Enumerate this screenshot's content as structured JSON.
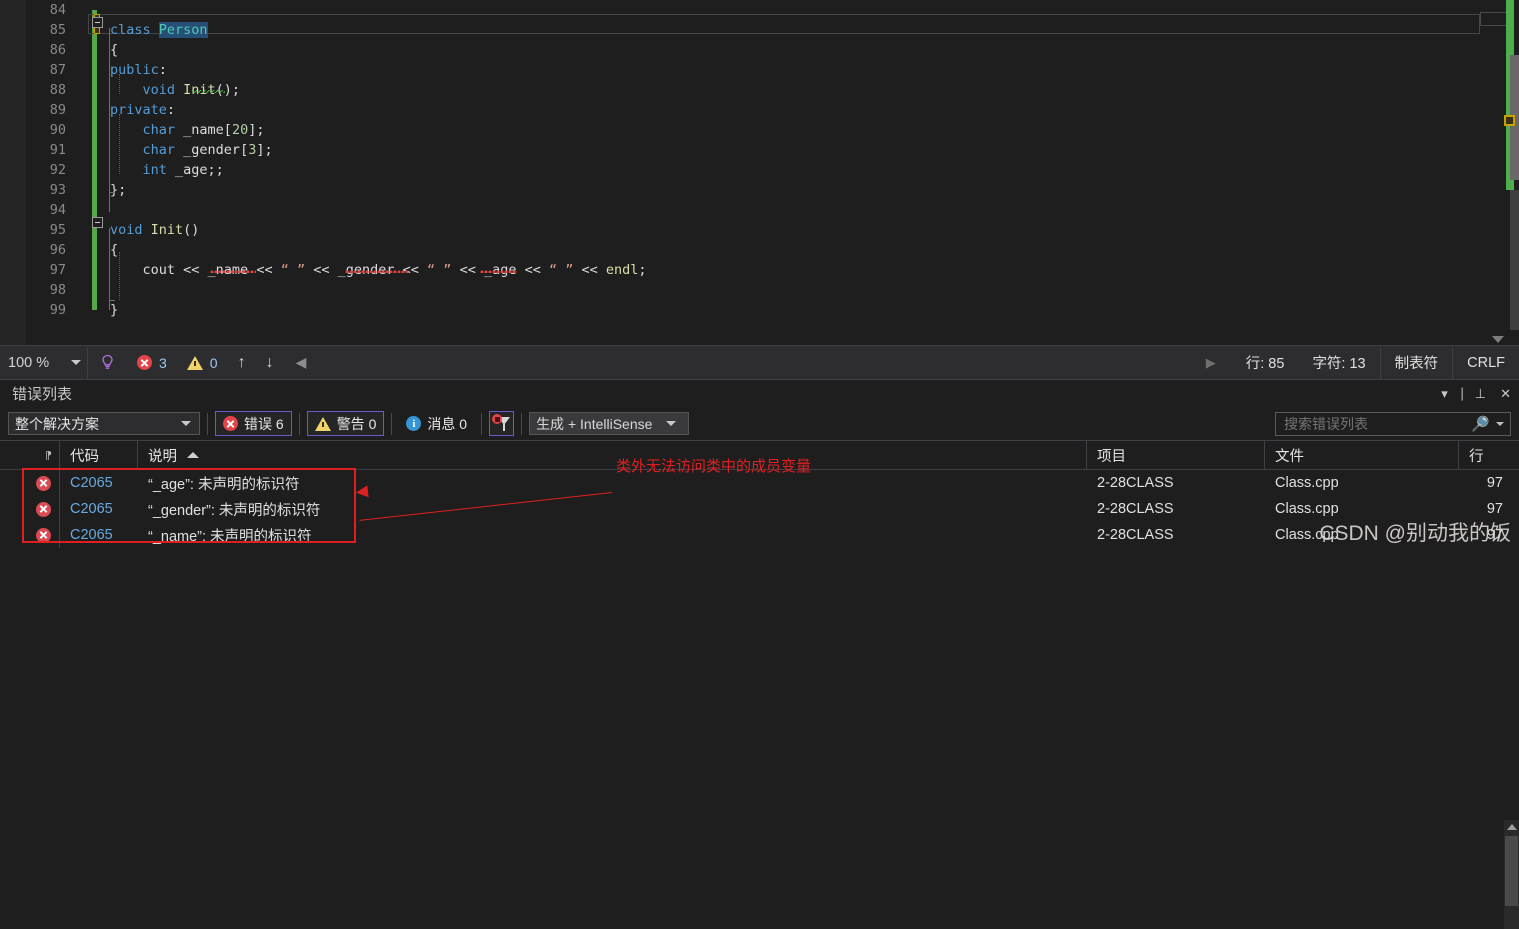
{
  "editor": {
    "lines": [
      {
        "no": "84",
        "tokens": []
      },
      {
        "no": "85",
        "tokens": [
          {
            "t": "class ",
            "c": "kw"
          },
          {
            "t": "Person",
            "c": "sel"
          }
        ]
      },
      {
        "no": "86",
        "tokens": [
          {
            "t": "{",
            "c": "punct"
          }
        ]
      },
      {
        "no": "87",
        "tokens": [
          {
            "t": "public",
            "c": "kw"
          },
          {
            "t": ":",
            "c": "punct"
          }
        ]
      },
      {
        "no": "88",
        "tokens": [
          {
            "t": "    ",
            "c": "idf"
          },
          {
            "t": "void ",
            "c": "kw"
          },
          {
            "t": "Init",
            "c": "fn"
          },
          {
            "t": "();",
            "c": "punct"
          }
        ]
      },
      {
        "no": "89",
        "tokens": [
          {
            "t": "private",
            "c": "kw"
          },
          {
            "t": ":",
            "c": "punct"
          }
        ]
      },
      {
        "no": "90",
        "tokens": [
          {
            "t": "    ",
            "c": "idf"
          },
          {
            "t": "char ",
            "c": "kw"
          },
          {
            "t": "_name",
            "c": "idf"
          },
          {
            "t": "[",
            "c": "punct"
          },
          {
            "t": "20",
            "c": "num"
          },
          {
            "t": "];",
            "c": "punct"
          }
        ]
      },
      {
        "no": "91",
        "tokens": [
          {
            "t": "    ",
            "c": "idf"
          },
          {
            "t": "char ",
            "c": "kw"
          },
          {
            "t": "_gender",
            "c": "idf"
          },
          {
            "t": "[",
            "c": "punct"
          },
          {
            "t": "3",
            "c": "num"
          },
          {
            "t": "];",
            "c": "punct"
          }
        ]
      },
      {
        "no": "92",
        "tokens": [
          {
            "t": "    ",
            "c": "idf"
          },
          {
            "t": "int ",
            "c": "kw"
          },
          {
            "t": "_age",
            "c": "idf"
          },
          {
            "t": ";;",
            "c": "punct"
          }
        ]
      },
      {
        "no": "93",
        "tokens": [
          {
            "t": "};",
            "c": "punct"
          }
        ]
      },
      {
        "no": "94",
        "tokens": []
      },
      {
        "no": "95",
        "tokens": [
          {
            "t": "void ",
            "c": "kw"
          },
          {
            "t": "Init",
            "c": "fn"
          },
          {
            "t": "()",
            "c": "punct"
          }
        ]
      },
      {
        "no": "96",
        "tokens": [
          {
            "t": "{",
            "c": "punct"
          }
        ]
      },
      {
        "no": "97",
        "tokens": [
          {
            "t": "    ",
            "c": "idf"
          },
          {
            "t": "cout ",
            "c": "idf"
          },
          {
            "t": "<< ",
            "c": "punct"
          },
          {
            "t": "_name ",
            "c": "idf"
          },
          {
            "t": "<< ",
            "c": "punct"
          },
          {
            "t": "“ ” ",
            "c": "str"
          },
          {
            "t": "<< ",
            "c": "punct"
          },
          {
            "t": "_gender ",
            "c": "idf"
          },
          {
            "t": "<< ",
            "c": "punct"
          },
          {
            "t": "“ ” ",
            "c": "str"
          },
          {
            "t": "<< ",
            "c": "punct"
          },
          {
            "t": "_age ",
            "c": "idf"
          },
          {
            "t": "<< ",
            "c": "punct"
          },
          {
            "t": "“ ” ",
            "c": "str"
          },
          {
            "t": "<< ",
            "c": "punct"
          },
          {
            "t": "endl",
            "c": "fn"
          },
          {
            "t": ";",
            "c": "punct"
          }
        ]
      },
      {
        "no": "98",
        "tokens": []
      },
      {
        "no": "99",
        "tokens": [
          {
            "t": "}",
            "c": "punct"
          }
        ]
      }
    ]
  },
  "statusbar": {
    "zoom": "100 %",
    "error_count": "3",
    "warning_count": "0",
    "line_label": "行: 85",
    "char_label": "字符: 13",
    "tabs_label": "制表符",
    "eol_label": "CRLF"
  },
  "panel": {
    "title": "错误列表",
    "toolbar": {
      "scope": "整个解决方案",
      "errors": "错误 6",
      "warnings": "警告 0",
      "messages": "消息 0",
      "build_source": "生成 + IntelliSense"
    },
    "search": {
      "placeholder": "搜索错误列表",
      "value": ""
    },
    "columns": {
      "code": "代码",
      "description": "说明",
      "project": "项目",
      "file": "文件",
      "line": "行"
    },
    "rows": [
      {
        "code": "C2065",
        "description": "“_age”: 未声明的标识符",
        "project": "2-28CLASS",
        "file": "Class.cpp",
        "line": "97"
      },
      {
        "code": "C2065",
        "description": "“_gender”: 未声明的标识符",
        "project": "2-28CLASS",
        "file": "Class.cpp",
        "line": "97"
      },
      {
        "code": "C2065",
        "description": "“_name”: 未声明的标识符",
        "project": "2-28CLASS",
        "file": "Class.cpp",
        "line": "97"
      }
    ]
  },
  "annotation": {
    "text": "类外无法访问类中的成员变量",
    "color": "#e02020"
  },
  "watermark": "CSDN @别动我的饭",
  "colors": {
    "editor_bg": "#1e1e1e",
    "keyword": "#569cd6",
    "type": "#4ec9b0",
    "function": "#dcdcaa",
    "number": "#b5cea8",
    "string": "#d69d85",
    "accent_purple": "#6a5acd",
    "error_red": "#e2444a",
    "change_green": "#57a64a"
  }
}
